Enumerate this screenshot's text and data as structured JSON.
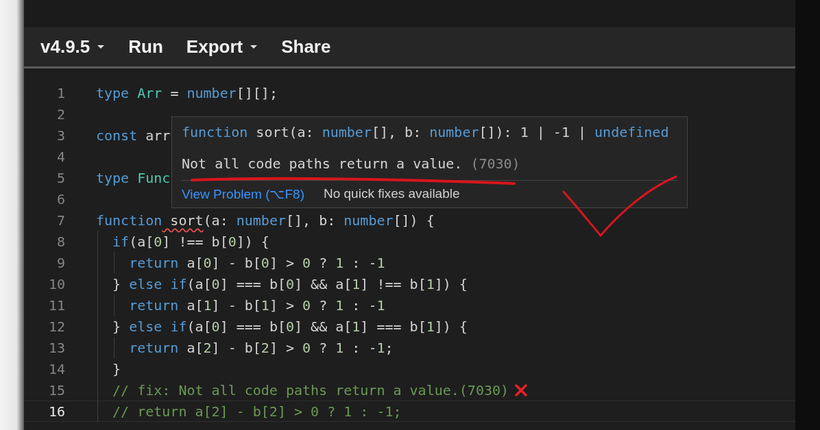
{
  "toolbar": [
    {
      "label": "v4.9.5",
      "menu": true
    },
    {
      "label": "Run",
      "menu": false
    },
    {
      "label": "Export",
      "menu": true
    },
    {
      "label": "Share",
      "menu": false
    }
  ],
  "lines": [
    {
      "n": "1",
      "current": false,
      "kind": "code",
      "tokens": [
        {
          "kind": "keyword",
          "t": "type"
        },
        {
          "kind": "type",
          "t": " Arr"
        },
        {
          "kind": "plain",
          "t": " = "
        },
        {
          "kind": "keyword",
          "t": "number"
        },
        {
          "kind": "plain",
          "t": "[][];"
        }
      ]
    },
    {
      "n": "2",
      "current": false,
      "kind": "code"
    },
    {
      "n": "3",
      "current": false,
      "kind": "code",
      "tokens": [
        {
          "kind": "keyword",
          "t": "const"
        },
        {
          "kind": "plain",
          "t": " arr"
        }
      ]
    },
    {
      "n": "4",
      "current": false,
      "kind": "code"
    },
    {
      "n": "5",
      "current": false,
      "kind": "code",
      "tokens": [
        {
          "kind": "keyword",
          "t": "type"
        },
        {
          "kind": "type",
          "t": " Func"
        }
      ]
    },
    {
      "n": "6",
      "current": false,
      "kind": "code"
    },
    {
      "n": "7",
      "current": false,
      "kind": "code",
      "tokens": [
        {
          "kind": "keyword",
          "t": "function"
        },
        {
          "kind": "error",
          "t": " sort"
        },
        {
          "kind": "plain",
          "t": "(a: "
        },
        {
          "kind": "keyword",
          "t": "number"
        },
        {
          "kind": "plain",
          "t": "[], b: "
        },
        {
          "kind": "keyword",
          "t": "number"
        },
        {
          "kind": "plain",
          "t": "[]) {"
        }
      ]
    },
    {
      "n": "8",
      "current": false,
      "kind": "code",
      "tokens": [
        {
          "kind": "keyword",
          "t": "  if"
        },
        {
          "kind": "plain",
          "t": "(a["
        },
        {
          "kind": "number",
          "t": "0"
        },
        {
          "kind": "plain",
          "t": "] !== b["
        },
        {
          "kind": "number",
          "t": "0"
        },
        {
          "kind": "plain",
          "t": "]) {"
        }
      ]
    },
    {
      "n": "9",
      "current": false,
      "kind": "code",
      "tokens": [
        {
          "kind": "keyword",
          "t": "    return"
        },
        {
          "kind": "plain",
          "t": " a["
        },
        {
          "kind": "number",
          "t": "0"
        },
        {
          "kind": "plain",
          "t": "] - b["
        },
        {
          "kind": "number",
          "t": "0"
        },
        {
          "kind": "plain",
          "t": "] > "
        },
        {
          "kind": "number",
          "t": "0"
        },
        {
          "kind": "plain",
          "t": " ? "
        },
        {
          "kind": "number",
          "t": "1"
        },
        {
          "kind": "plain",
          "t": " : -"
        },
        {
          "kind": "number",
          "t": "1"
        }
      ]
    },
    {
      "n": "10",
      "current": false,
      "kind": "code",
      "tokens": [
        {
          "kind": "plain",
          "t": "  } "
        },
        {
          "kind": "keyword",
          "t": "else if"
        },
        {
          "kind": "plain",
          "t": "(a["
        },
        {
          "kind": "number",
          "t": "0"
        },
        {
          "kind": "plain",
          "t": "] === b["
        },
        {
          "kind": "number",
          "t": "0"
        },
        {
          "kind": "plain",
          "t": "] && a["
        },
        {
          "kind": "number",
          "t": "1"
        },
        {
          "kind": "plain",
          "t": "] !== b["
        },
        {
          "kind": "number",
          "t": "1"
        },
        {
          "kind": "plain",
          "t": "]) {"
        }
      ]
    },
    {
      "n": "11",
      "current": false,
      "kind": "code",
      "tokens": [
        {
          "kind": "keyword",
          "t": "    return"
        },
        {
          "kind": "plain",
          "t": " a["
        },
        {
          "kind": "number",
          "t": "1"
        },
        {
          "kind": "plain",
          "t": "] - b["
        },
        {
          "kind": "number",
          "t": "1"
        },
        {
          "kind": "plain",
          "t": "] > "
        },
        {
          "kind": "number",
          "t": "0"
        },
        {
          "kind": "plain",
          "t": " ? "
        },
        {
          "kind": "number",
          "t": "1"
        },
        {
          "kind": "plain",
          "t": " : -"
        },
        {
          "kind": "number",
          "t": "1"
        }
      ]
    },
    {
      "n": "12",
      "current": false,
      "kind": "code",
      "tokens": [
        {
          "kind": "plain",
          "t": "  } "
        },
        {
          "kind": "keyword",
          "t": "else if"
        },
        {
          "kind": "plain",
          "t": "(a["
        },
        {
          "kind": "number",
          "t": "0"
        },
        {
          "kind": "plain",
          "t": "] === b["
        },
        {
          "kind": "number",
          "t": "0"
        },
        {
          "kind": "plain",
          "t": "] && a["
        },
        {
          "kind": "number",
          "t": "1"
        },
        {
          "kind": "plain",
          "t": "] === b["
        },
        {
          "kind": "number",
          "t": "1"
        },
        {
          "kind": "plain",
          "t": "]) {"
        }
      ]
    },
    {
      "n": "13",
      "current": false,
      "kind": "code",
      "tokens": [
        {
          "kind": "keyword",
          "t": "    return"
        },
        {
          "kind": "plain",
          "t": " a["
        },
        {
          "kind": "number",
          "t": "2"
        },
        {
          "kind": "plain",
          "t": "] - b["
        },
        {
          "kind": "number",
          "t": "2"
        },
        {
          "kind": "plain",
          "t": "] > "
        },
        {
          "kind": "number",
          "t": "0"
        },
        {
          "kind": "plain",
          "t": " ? "
        },
        {
          "kind": "number",
          "t": "1"
        },
        {
          "kind": "plain",
          "t": " : -"
        },
        {
          "kind": "number",
          "t": "1"
        },
        {
          "kind": "plain",
          "t": ";"
        }
      ]
    },
    {
      "n": "14",
      "current": false,
      "kind": "code",
      "tokens": [
        {
          "kind": "plain",
          "t": "  }"
        }
      ]
    },
    {
      "n": "15",
      "current": false,
      "kind": "flagged",
      "tokens": [
        {
          "kind": "comment",
          "t": "  // fix: Not all code paths return a value.(7030)"
        }
      ]
    },
    {
      "n": "16",
      "current": true,
      "kind": "code",
      "tokens": [
        {
          "kind": "comment",
          "t": "  // return a[2] - b[2] > 0 ? 1 : -1;"
        }
      ]
    }
  ],
  "hover": {
    "signature": [
      {
        "kind": "keyword",
        "t": "function"
      },
      {
        "kind": "plain",
        "t": " sort(a: "
      },
      {
        "kind": "keyword",
        "t": "number"
      },
      {
        "kind": "plain",
        "t": "[], b: "
      },
      {
        "kind": "keyword",
        "t": "number"
      },
      {
        "kind": "plain",
        "t": "[]): 1 | -1 | "
      },
      {
        "kind": "keyword",
        "t": "undefined"
      }
    ],
    "message": "Not all code paths return a value.",
    "code": "(7030)",
    "link": "View Problem (⌥F8)",
    "note": "No quick fixes available"
  }
}
